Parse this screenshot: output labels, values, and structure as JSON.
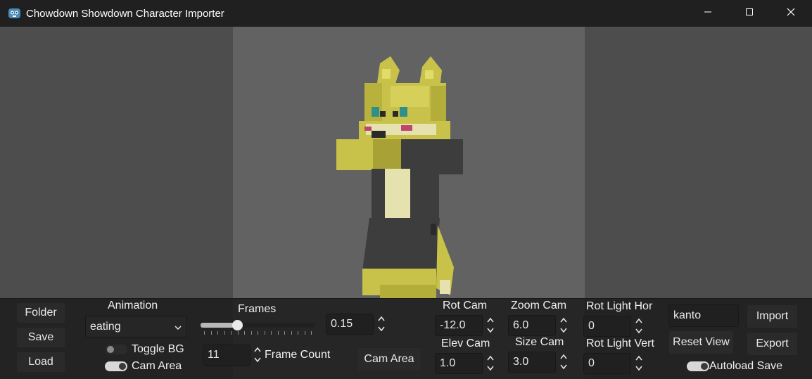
{
  "window": {
    "title": "Chowdown Showdown Character Importer",
    "icon": "godot-icon",
    "controls": [
      "minimize-icon",
      "maximize-icon",
      "close-icon"
    ]
  },
  "panel": {
    "buttons": {
      "folder": "Folder",
      "save": "Save",
      "load": "Load",
      "cam_area": "Cam Area",
      "import": "Import",
      "reset_view": "Reset View",
      "export": "Export"
    },
    "animation": {
      "label": "Animation",
      "selected": "eating"
    },
    "toggles": {
      "toggle_bg": {
        "label": "Toggle BG",
        "on": false
      },
      "cam_area": {
        "label": "Cam Area",
        "on": true
      },
      "autoload_save": {
        "label": "Autoload Save",
        "on": true
      }
    },
    "frames": {
      "label": "Frames",
      "slider_fraction": 0.32,
      "speed_value": "0.15",
      "frame_count_value": "11",
      "frame_count_label": "Frame Count"
    },
    "camera": {
      "rot_cam_label": "Rot Cam",
      "rot_cam_value": "-12.0",
      "elev_cam_label": "Elev Cam",
      "elev_cam_value": "1.0",
      "zoom_cam_label": "Zoom Cam",
      "zoom_cam_value": "6.0",
      "size_cam_label": "Size Cam",
      "size_cam_value": "3.0"
    },
    "light": {
      "rot_hor_label": "Rot Light Hor",
      "rot_hor_value": "0",
      "rot_vert_label": "Rot Light Vert",
      "rot_vert_value": "0"
    },
    "character_name": "kanto"
  },
  "colors": {
    "viewport_bg": "#4d4d4d",
    "cam_area_bg": "#626262",
    "panel_bg": "#1c1c1c",
    "character_yellow": "#c8c24a",
    "character_dark": "#3d3d3d",
    "character_cream": "#e6e2b0"
  }
}
